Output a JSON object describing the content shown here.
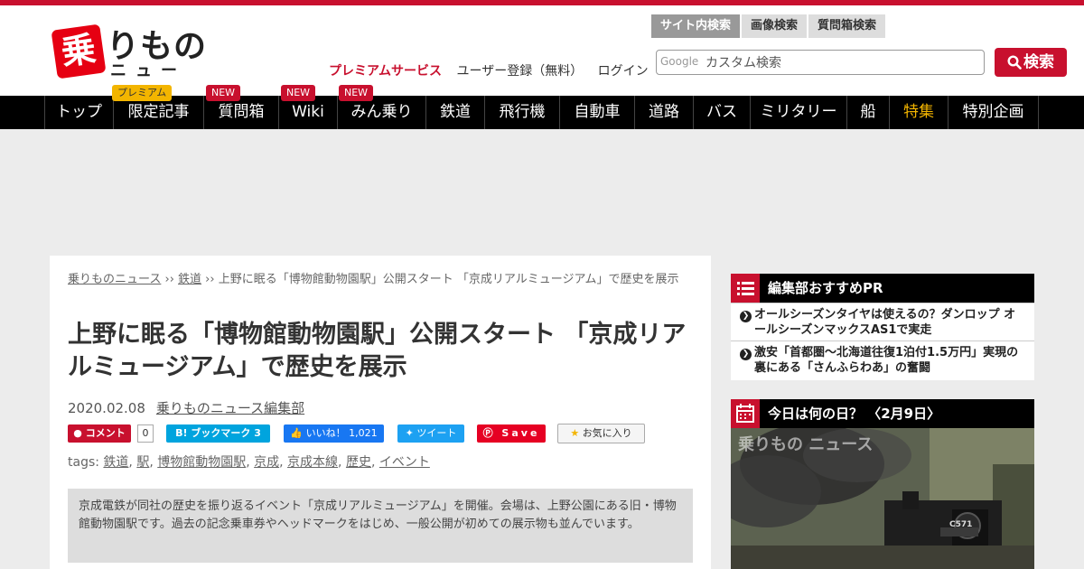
{
  "header": {
    "logo": {
      "kanji": "乗",
      "kana": "りもの",
      "sub": "ニュース"
    },
    "links": {
      "premium": "プレミアムサービス",
      "register": "ユーザー登録（無料）",
      "login": "ログイン"
    },
    "search_tabs": [
      "サイト内検索",
      "画像検索",
      "質問箱検索"
    ],
    "search": {
      "google": "Google",
      "placeholder": "カスタム検索",
      "button": "検索"
    }
  },
  "nav": {
    "items": [
      "トップ",
      "限定記事",
      "質問箱",
      "Wiki",
      "みん乗り",
      "鉄道",
      "飛行機",
      "自動車",
      "道路",
      "バス",
      "ミリタリー",
      "船",
      "特集",
      "特別企画"
    ],
    "badges": {
      "premium": "プレミアム",
      "new": "NEW"
    }
  },
  "article": {
    "breadcrumb": {
      "home": "乗りものニュース",
      "sep": " ›› ",
      "category": "鉄道",
      "current": "上野に眠る「博物館動物園駅」公開スタート 「京成リアルミュージアム」で歴史を展示"
    },
    "title": "上野に眠る「博物館動物園駅」公開スタート 「京成リアルミュージアム」で歴史を展示",
    "date": "2020.02.08",
    "author": "乗りものニュース編集部",
    "share": {
      "comment": "コメント",
      "comment_count": "0",
      "hatena": "B! ブックマーク  3",
      "like": "いいね！ 1,021",
      "tweet": "ツイート",
      "pin": "Save",
      "fav": "お気に入り"
    },
    "tags_label": "tags:",
    "tags": [
      "鉄道",
      "駅",
      "博物館動物園駅",
      "京成",
      "京成本線",
      "歴史",
      "イベント"
    ],
    "lead": "京成電鉄が同社の歴史を振り返るイベント「京成リアルミュージアム」を開催。会場は、上野公園にある旧・博物館動物園駅です。過去の記念乗車券やヘッドマークをはじめ、一般公開が初めての展示物も並んでいます。"
  },
  "sidebar": {
    "pr": {
      "title": "編集部おすすめPR",
      "items": [
        "オールシーズンタイヤは使えるの？ダンロップ オールシーズンマックスAS1で実走",
        "激安「首都圏～北海道往復1泊付1.5万円」実現の裏にある「さんふらわあ」の奮闘"
      ]
    },
    "today": {
      "title": "今日は何の日？ 〈2月9日〉",
      "watermark": "乗りもの ニュース",
      "loco_number": "C571"
    }
  }
}
